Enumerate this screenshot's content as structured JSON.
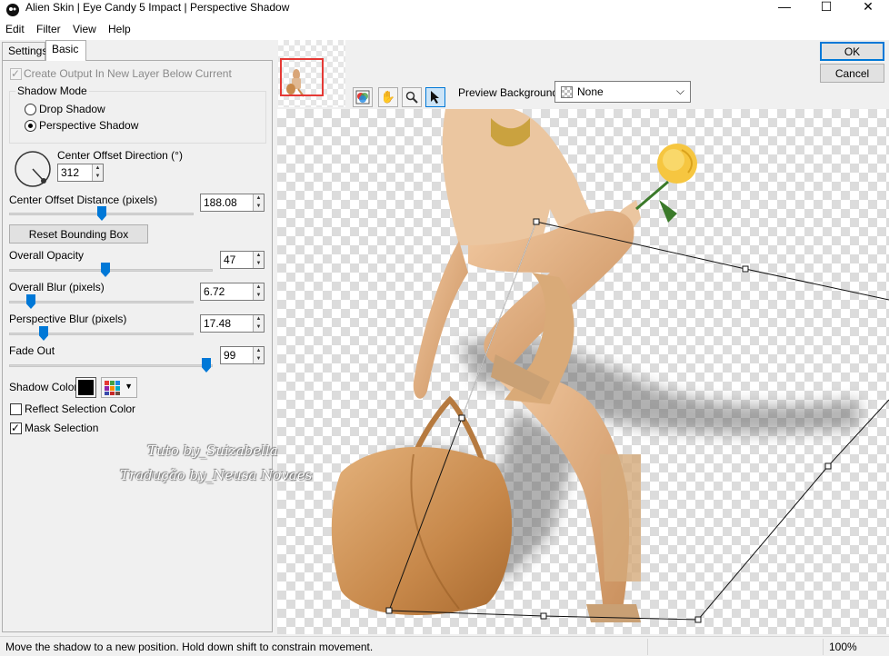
{
  "window": {
    "title": "Alien Skin | Eye Candy 5 Impact | Perspective Shadow",
    "minimize": "—",
    "maximize": "☐",
    "close": "✕"
  },
  "menu": {
    "items": [
      "Edit",
      "Filter",
      "View",
      "Help"
    ]
  },
  "tabs": {
    "settings": "Settings",
    "basic": "Basic",
    "active": "Basic"
  },
  "basic": {
    "create_output": {
      "label": "Create Output In New Layer Below Current",
      "checked": true,
      "enabled": false
    },
    "shadow_mode": {
      "legend": "Shadow Mode",
      "options": [
        {
          "label": "Drop Shadow",
          "selected": false
        },
        {
          "label": "Perspective Shadow",
          "selected": true
        }
      ]
    },
    "center_offset_direction": {
      "label": "Center Offset Direction (°)",
      "value": "312"
    },
    "center_offset_distance": {
      "label": "Center Offset Distance (pixels)",
      "value": "188.08",
      "slider_fraction": 0.5
    },
    "reset_bounding_box": "Reset Bounding Box",
    "overall_opacity": {
      "label": "Overall Opacity",
      "value": "47",
      "slider_fraction": 0.47
    },
    "overall_blur": {
      "label": "Overall Blur (pixels)",
      "value": "6.72",
      "slider_fraction": 0.1
    },
    "perspective_blur": {
      "label": "Perspective Blur (pixels)",
      "value": "17.48",
      "slider_fraction": 0.17
    },
    "fade_out": {
      "label": "Fade Out",
      "value": "99",
      "slider_fraction": 0.99
    },
    "shadow_color": {
      "label": "Shadow Color",
      "color": "#000000"
    },
    "reflect_selection_color": {
      "label": "Reflect Selection Color",
      "checked": false
    },
    "mask_selection": {
      "label": "Mask Selection",
      "checked": true
    }
  },
  "buttons": {
    "ok": "OK",
    "cancel": "Cancel"
  },
  "toolbar": {
    "tools": [
      "preview-toggle-icon",
      "hand-icon",
      "zoom-icon",
      "arrow-pointer-icon"
    ],
    "active_tool": "arrow-pointer-icon",
    "preview_background_label": "Preview Background:",
    "preview_background_value": "None"
  },
  "watermark": {
    "line1": "Tuto by_Suizabella",
    "line2": "Tradução by_Neusa Novaes"
  },
  "statusbar": {
    "message": "Move the shadow to a new position. Hold down shift to constrain movement.",
    "zoom": "100%"
  },
  "colors": {
    "accent": "#0078d7",
    "thumbnail_frame": "#e53935"
  }
}
